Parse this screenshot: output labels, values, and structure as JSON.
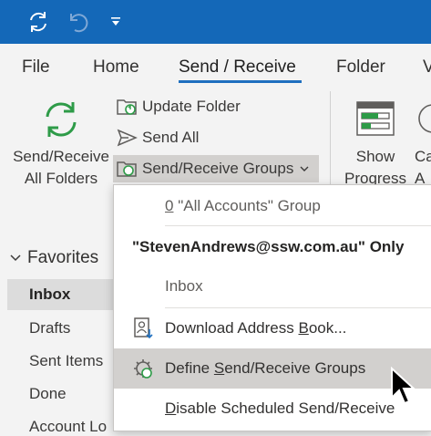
{
  "quick_access": {
    "sync_icon": "sync-icon",
    "undo_icon": "undo-icon",
    "customize_icon": "customize-qat-icon"
  },
  "tabs": [
    {
      "label": "File"
    },
    {
      "label": "Home"
    },
    {
      "label": "Send / Receive",
      "active": true
    },
    {
      "label": "Folder"
    },
    {
      "label": "V"
    }
  ],
  "ribbon": {
    "send_receive_all": {
      "line1": "Send/Receive",
      "line2": "All Folders"
    },
    "update_folder": "Update Folder",
    "send_all": "Send All",
    "send_receive_groups": "Send/Receive Groups",
    "show_progress": {
      "line1": "Show",
      "line2": "Progress"
    },
    "cancel_partial": {
      "line1": "Ca",
      "line2": "A"
    }
  },
  "nav": {
    "favorites": "Favorites",
    "items": [
      "Inbox",
      "Drafts",
      "Sent Items",
      "Done",
      "Account Lo"
    ]
  },
  "dropdown": {
    "all_accounts_prefix": "0",
    "all_accounts_rest": " \"All Accounts\" Group",
    "account_header": "\"StevenAndrews@ssw.com.au\" Only",
    "inbox": "Inbox",
    "download_pre": "Download Address ",
    "download_key": "B",
    "download_post": "ook...",
    "define_pre": "Define ",
    "define_key": "S",
    "define_post": "end/Receive Groups",
    "disable_key": "D",
    "disable_post": "isable Scheduled Send/Receive"
  },
  "colors": {
    "title_bar": "#1468b8",
    "accent": "#1f6fbf",
    "sync_green": "#2e9b48",
    "hover": "#d2d0ce"
  }
}
